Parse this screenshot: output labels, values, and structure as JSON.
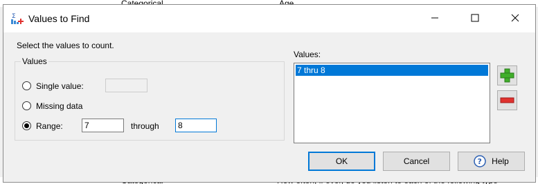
{
  "background_app": {
    "top_row": {
      "type_cell": "Categorical",
      "name_cell": "Age"
    },
    "bottom_row": {
      "type_cell": "Categorical",
      "label_cell": "How often, if ever, do you listen to each of the following type"
    }
  },
  "dialog": {
    "title": "Values to Find",
    "prompt": "Select the values to count.",
    "group_title": "Values",
    "options": {
      "single_value_label": "Single value:",
      "single_value": "",
      "missing_label": "Missing data",
      "range_label": "Range:",
      "range_from": "7",
      "through_label": "through",
      "range_to": "8",
      "selected": "range"
    },
    "values_list": {
      "label": "Values:",
      "items": [
        "7 thru 8"
      ],
      "selected_index": 0
    },
    "buttons": {
      "ok": "OK",
      "cancel": "Cancel",
      "help": "Help"
    },
    "icons": {
      "add": "plus-icon",
      "remove": "minus-icon",
      "help": "help-icon",
      "app": "app-icon"
    },
    "colors": {
      "selection": "#0078d7",
      "add_green": "#3fae29",
      "remove_red": "#e0312e"
    }
  }
}
